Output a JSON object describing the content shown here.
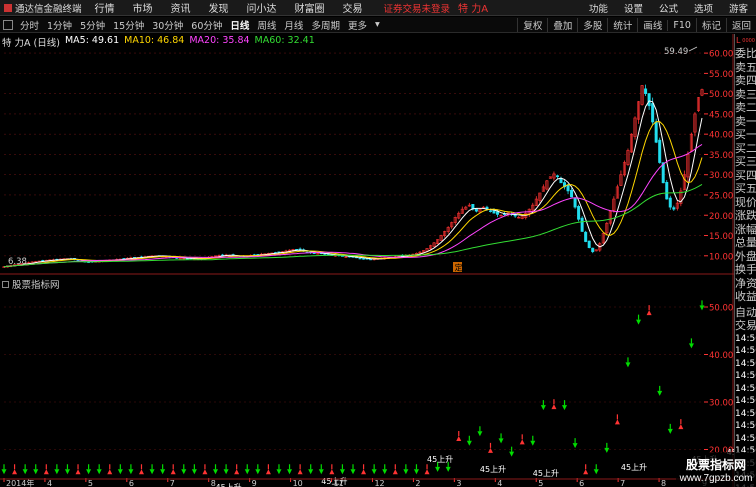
{
  "app": {
    "logo_text": "通达信金融终端"
  },
  "menu": {
    "items": [
      "行情",
      "市场",
      "资讯",
      "发现",
      "问小达",
      "财富圈",
      "交易"
    ],
    "warning": "证券交易未登录",
    "stock": "特 力A",
    "right": [
      "功能",
      "设置",
      "公式",
      "选项",
      "游客"
    ]
  },
  "toolbar": {
    "periods": [
      "分时",
      "1分钟",
      "5分钟",
      "15分钟",
      "30分钟",
      "60分钟",
      "日线",
      "周线",
      "月线",
      "多周期",
      "更多"
    ],
    "active": "日线",
    "right": [
      "复权",
      "叠加",
      "多股",
      "统计",
      "画线",
      "F10",
      "标记",
      "返回"
    ]
  },
  "main_legend": {
    "title": "特 力A (日线)",
    "ma5": "MA5: 49.61",
    "ma10": "MA10: 46.84",
    "ma20": "MA20: 35.84",
    "ma60": "MA60: 32.41"
  },
  "colors": {
    "ma5": "#ffffff",
    "ma10": "#ffd700",
    "ma20": "#ff44ff",
    "ma60": "#33dd33",
    "up": "#ff3333",
    "down": "#00dd00",
    "axis": "#ff3333",
    "grid": "#5a1010"
  },
  "sub_legend": {
    "title": "股票指标网"
  },
  "price_axis": {
    "labels": [
      "60.00",
      "55.00",
      "50.00",
      "45.00",
      "40.00",
      "35.00",
      "30.00",
      "25.00",
      "20.00",
      "15.00",
      "10.00"
    ]
  },
  "sub_axis": {
    "labels": [
      "50.00",
      "40.00",
      "30.00",
      "20.00"
    ]
  },
  "annotations": {
    "max": "59.49",
    "min": "6.38",
    "marker": "定"
  },
  "rise_label": "45上升",
  "date_axis": {
    "labels": [
      "2014年",
      "4",
      "5",
      "6",
      "7",
      "8",
      "9",
      "10",
      "11",
      "12",
      "2",
      "3",
      "4",
      "5",
      "6",
      "7",
      "8",
      "9"
    ]
  },
  "right_panel": {
    "head_left": "L",
    "head_right": "0000",
    "items": [
      "委比",
      "卖五",
      "卖四",
      "卖三",
      "卖二",
      "卖一",
      "买一",
      "买二",
      "买三",
      "买四",
      "买五",
      "现价",
      "涨跌",
      "涨幅",
      "总量",
      "外盘",
      "换手",
      "净资",
      "收益"
    ],
    "auto": [
      "自动",
      "交易"
    ],
    "times": [
      "14:50",
      "14:50",
      "14:50",
      "14:50",
      "14:50",
      "14:50",
      "14:50",
      "14:50",
      "14:50",
      "14:50",
      "14:50",
      "14:50",
      "14:50",
      "14:50"
    ]
  },
  "watermark": {
    "title": "股票指标网",
    "url": "www.7gpzb.com"
  },
  "chart_data": {
    "type": "candlestick",
    "ylim_main": [
      6,
      62
    ],
    "ylim_sub": [
      14,
      54
    ],
    "close": [
      7.3,
      7.5,
      7.6,
      7.8,
      7.9,
      8,
      8.2,
      8.3,
      8.5,
      8.6,
      8.7,
      8.8,
      8.9,
      9,
      9,
      9.1,
      9.2,
      9.3,
      9.3,
      9.2,
      9,
      8.8,
      8.7,
      8.6,
      8.5,
      8.5,
      8.6,
      8.7,
      8.8,
      8.9,
      9,
      9,
      9.1,
      9.2,
      9.3,
      9.4,
      9.5,
      9.6,
      9.6,
      9.7,
      9.8,
      9.9,
      10,
      10,
      10,
      9.9,
      9.8,
      9.7,
      9.6,
      9.5,
      9.4,
      9.4,
      9.3,
      9.3,
      9.2,
      9.2,
      9.3,
      9.4,
      9.6,
      9.8,
      10,
      10.1,
      10.2,
      10.2,
      10.1,
      10,
      9.9,
      9.8,
      9.9,
      10,
      10.1,
      10.2,
      10.3,
      10.4,
      10.5,
      10.6,
      10.7,
      10.8,
      10.9,
      11,
      11.2,
      11.4,
      11.6,
      11.5,
      11.3,
      11.1,
      10.9,
      10.8,
      10.7,
      10.6,
      10.5,
      10.4,
      10.3,
      10.2,
      10.1,
      10,
      9.9,
      9.8,
      9.7,
      9.6,
      9.5,
      9.4,
      9.3,
      9.2,
      9.1,
      9.2,
      9.3,
      9.4,
      9.5,
      9.6,
      9.7,
      9.8,
      9.9,
      10,
      10.1,
      10.2,
      10.4,
      10.6,
      10.9,
      11.3,
      11.8,
      12.5,
      13.2,
      14,
      15,
      16,
      17,
      18.2,
      19.5,
      20.5,
      21.5,
      22,
      22.5,
      21.5,
      21,
      21.5,
      22,
      21.5,
      21,
      20.5,
      20.2,
      20,
      20.3,
      20.6,
      20.2,
      19.8,
      19.5,
      19.8,
      20.5,
      21.5,
      22.5,
      24,
      25.5,
      27,
      28.5,
      29.5,
      30.2,
      29.5,
      28,
      27,
      26,
      24.5,
      22,
      19,
      16,
      13.5,
      12,
      11,
      11.5,
      13,
      15.5,
      18,
      21,
      24,
      27,
      30,
      33,
      36,
      40,
      44,
      48,
      52,
      50,
      47,
      43,
      38,
      33,
      28,
      24,
      22,
      21.5,
      23,
      26,
      30,
      35,
      40,
      45,
      49,
      51
    ]
  }
}
